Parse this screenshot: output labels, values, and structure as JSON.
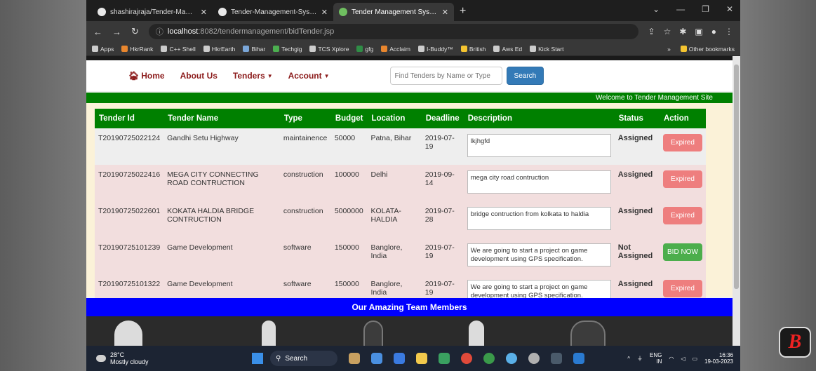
{
  "browser": {
    "tabs": [
      {
        "title": "shashirajraja/Tender-Manageme",
        "icon": "github-icon"
      },
      {
        "title": "Tender-Management-System/ho",
        "icon": "github-icon"
      },
      {
        "title": "Tender Management System",
        "icon": "globe-icon",
        "active": true
      }
    ],
    "new_tab": "+",
    "url_host": "localhost",
    "url_rest": ":8082/tendermanagement/bidTender.jsp",
    "bookmarks": [
      "Apps",
      "HkrRank",
      "C++ Shell",
      "HkrEarth",
      "Bihar",
      "Techgig",
      "TCS Xplore",
      "gfg",
      "Acclaim",
      "I-Buddy™",
      "British",
      "Aws Ed",
      "Kick Start"
    ],
    "bookmarks_more": "»",
    "other_bookmarks": "Other bookmarks"
  },
  "nav": {
    "home": "Home",
    "about": "About Us",
    "tenders": "Tenders",
    "account": "Account",
    "search_placeholder": "Find Tenders by Name or Type",
    "search_button": "Search"
  },
  "welcome": "Welcome to Tender Management Site",
  "table": {
    "headers": [
      "Tender Id",
      "Tender Name",
      "Type",
      "Budget",
      "Location",
      "Deadline",
      "Description",
      "Status",
      "Action"
    ],
    "rows": [
      {
        "id": "T20190725022124",
        "name": "Gandhi Setu Highway",
        "type": "maintainence",
        "budget": "50000",
        "location": "Patna, Bihar",
        "deadline": "2019-07-19",
        "description": "lkjhgfd",
        "status": "Assigned",
        "action": "Expired"
      },
      {
        "id": "T20190725022416",
        "name": "MEGA CITY CONNECTING ROAD CONTRUCTION",
        "type": "construction",
        "budget": "100000",
        "location": "Delhi",
        "deadline": "2019-09-14",
        "description": "mega city road contruction",
        "status": "Assigned",
        "action": "Expired"
      },
      {
        "id": "T20190725022601",
        "name": "KOKATA HALDIA BRIDGE CONTRUCTION",
        "type": "construction",
        "budget": "5000000",
        "location": "KOLATA-HALDIA",
        "deadline": "2019-07-28",
        "description": "bridge contruction from kolkata to haldia",
        "status": "Assigned",
        "action": "Expired"
      },
      {
        "id": "T20190725101239",
        "name": "Game Development",
        "type": "software",
        "budget": "150000",
        "location": "Banglore, India",
        "deadline": "2019-07-19",
        "description": "We are going to start a project on game development using GPS specification.",
        "status": "Not Assigned",
        "action": "BID NOW"
      },
      {
        "id": "T20190725101322",
        "name": "Game Development",
        "type": "software",
        "budget": "150000",
        "location": "Banglore, India",
        "deadline": "2019-07-19",
        "description": "We are going to start a project on game development using GPS specification.",
        "status": "Assigned",
        "action": "Expired"
      }
    ]
  },
  "team_heading": "Our Amazing Team Members",
  "taskbar": {
    "temperature": "28°C",
    "weather": "Mostly cloudy",
    "search": "Search",
    "lang": "ENG",
    "region": "IN",
    "time": "16:36",
    "date": "19-03-2023"
  },
  "colors": {
    "nav_link": "#8b1a1a",
    "header_green": "#008000",
    "team_blue": "#0000ff",
    "expired": "#ee7e7e",
    "bid": "#4cae4c"
  }
}
